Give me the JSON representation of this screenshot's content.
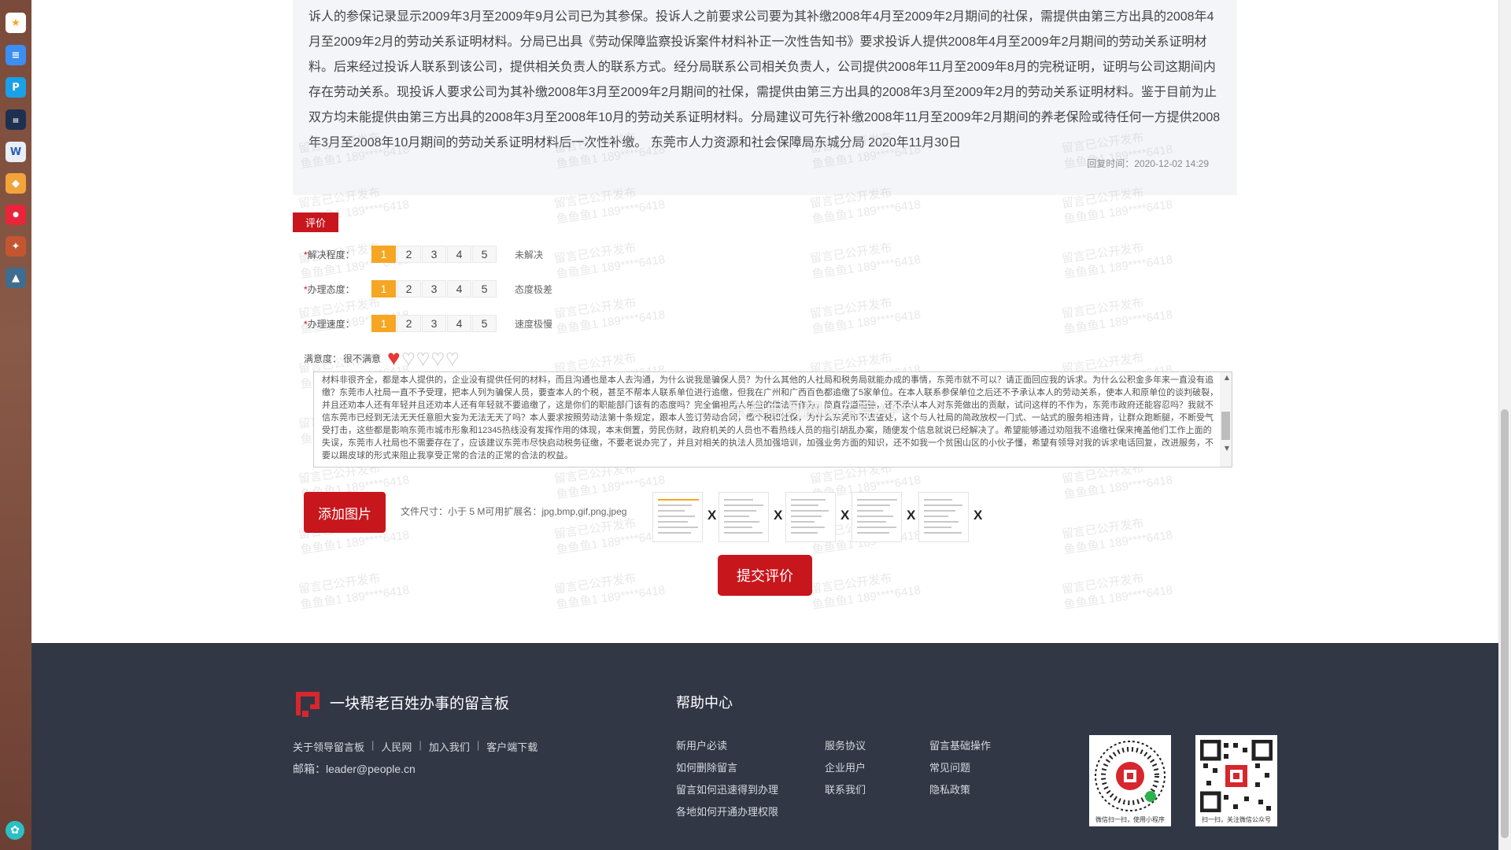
{
  "reply": {
    "text": "诉人的参保记录显示2009年3月至2009年9月公司已为其参保。投诉人之前要求公司要为其补缴2008年4月至2009年2月期间的社保，需提供由第三方出具的2008年4月至2009年2月的劳动关系证明材料。分局已出具《劳动保障监察投诉案件材料补正一次性告知书》要求投诉人提供2008年4月至2009年2月期间的劳动关系证明材料。后来经过投诉人联系到该公司，提供相关负责人的联系方式。经分局联系公司相关负责人，公司提供2008年11月至2009年8月的完税证明，证明与公司这期间内存在劳动关系。现投诉人要求公司为其补缴2008年3月至2009年2月期间的社保，需提供由第三方出具的2008年3月至2009年2月的劳动关系证明材料。鉴于目前为止双方均未能提供由第三方出具的2008年3月至2008年10月的劳动关系证明材料。分局建议可先行补缴2008年11月至2009年2月期间的养老保险或待任何一方提供2008年3月至2008年10月期间的劳动关系证明材料后一次性补缴。 东莞市人力资源和社会保障局东城分局 2020年11月30日",
    "time": "回复时间：2020-12-02 14:29"
  },
  "watermark": {
    "line1": "留言已公开发布",
    "line2": "鱼鱼鱼1 189****6418"
  },
  "evaluation": {
    "tag": "评价",
    "required_mark": "*",
    "rows": [
      {
        "label": "解决程度：",
        "desc": "未解决",
        "selected": 1
      },
      {
        "label": "办理态度：",
        "desc": "态度极差",
        "selected": 1
      },
      {
        "label": "办理速度：",
        "desc": "速度极慢",
        "selected": 1
      }
    ],
    "scale": [
      "1",
      "2",
      "3",
      "4",
      "5"
    ],
    "satisfaction_label": "满意度：",
    "satisfaction_value": "很不满意",
    "satisfaction_level": 1,
    "satisfaction_max": 5,
    "comment": "材料非很齐全，都是本人提供的，企业没有提供任何的材料，而且沟通也是本人去沟通，为什么说我是骗保人员？为什么其他的人社局和税务局就能办成的事情，东莞市就不可以？请正面回应我的诉求。为什么公积金多年来一直没有追缴？东莞市人社局一直不予受理，把本人列为骗保人员，要查本人的个税，甚至不帮本人联系单位进行追缴，但我在广州和广西百色都追缴了5家单位。在本人联系参保单位之后还不予承认本人的劳动关系，使本人和原单位的谈判破裂，并且还劝本人还有年轻并且还劝本人还有年轻就不要追缴了，这是你们的职能部门该有的态度吗？完全偏袒用人单位的做法不作为，简直背道而驰，还不承认本人对东莞做出的贡献，试问这样的不作为，东莞市政府还能容忍吗？我就不信东莞市已经到无法无天任意胆大妄为无法无天了吗？本人要求按照劳动法第十条规定，跟本人签订劳动合同，缴个税和社保，为什么东莞市不去查处，这个与人社局的简政放权一门式、一站式的服务相违背，让群众跑断腿，不断受气受打击，这些都是影响东莞市城市形象和12345热线没有发挥作用的体现，本末倒置，劳民伤财，政府机关的人员也不看热线人员的指引胡乱办案，随便发个信息就说已经解决了。希望能够通过劝阻我不追缴社保来掩盖他们工作上面的失误，东莞市人社局也不需要存在了，应该建议东莞市尽快启动税务征缴，不要老说办完了，并且对相关的执法人员加强培训，加强业务方面的知识，还不如我一个贫困山区的小伙子懂，希望有领导对我的诉求电话回复，改进服务，不要以踢皮球的形式来阻止我享受正常的合法的正常的合法的权益。",
    "overlay": "东莞电视网&i东莞APP"
  },
  "upload": {
    "add_label": "添加图片",
    "hint": "文件尺寸：小于 5 M可用扩展名：jpg,bmp,gif,png,jpeg",
    "remove_label": "X",
    "thumb_count": 5
  },
  "submit_label": "提交评价",
  "footer": {
    "slogan": "一块帮老百姓办事的留言板",
    "links": [
      "关于领导留言板",
      "人民网",
      "加入我们",
      "客户端下载"
    ],
    "link_sep": "|",
    "email": "邮箱：leader@people.cn",
    "help_title": "帮助中心",
    "help_col1": [
      "新用户必读",
      "如何删除留言",
      "留言如何迅速得到办理",
      "各地如何开通办理权限"
    ],
    "help_col2": [
      "服务协议",
      "企业用户",
      "联系我们"
    ],
    "help_col3": [
      "留言基础操作",
      "常见问题",
      "隐私政策"
    ],
    "qr1_caption": "微信扫一扫，使用小程序",
    "qr2_caption": "扫一扫，关注微信公众号"
  },
  "colors": {
    "brand_red": "#c8161d",
    "rating_orange": "#f5a623",
    "footer_bg": "#313745"
  },
  "dock_icons": [
    "star-app",
    "doc-app",
    "p-app",
    "news-app",
    "word-app",
    "game-app-1",
    "shop-app",
    "game-app-2",
    "game-app-3",
    "assistant-app"
  ]
}
